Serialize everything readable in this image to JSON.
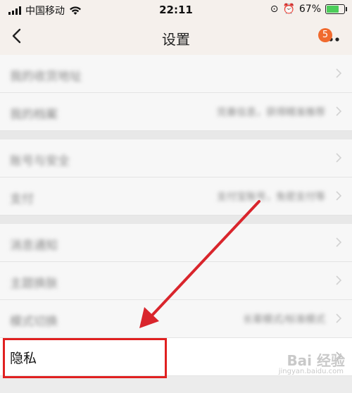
{
  "status_bar": {
    "carrier": "中国移动",
    "time": "22:11",
    "battery": "67%",
    "battery_level": 0.67
  },
  "nav": {
    "title": "设置",
    "badge": "5"
  },
  "rows": [
    {
      "label": "我的收货地址",
      "value": ""
    },
    {
      "label": "我的档案",
      "value": "完善信息，获得精准推荐"
    },
    {
      "label": "账号与安全",
      "value": ""
    },
    {
      "label": "支付",
      "value": "支付宝账号，免密支付等"
    },
    {
      "label": "消息通知",
      "value": ""
    },
    {
      "label": "主题换肤",
      "value": ""
    },
    {
      "label": "模式切换",
      "value": "长辈模式/标准模式"
    },
    {
      "label": "隐私",
      "value": ""
    }
  ],
  "watermark": {
    "text": "Bai 经验",
    "sub": "jingyan.baidu.com"
  },
  "colors": {
    "highlight": "#e02020",
    "badge": "#f06a2e",
    "arrow": "#d9252c"
  }
}
